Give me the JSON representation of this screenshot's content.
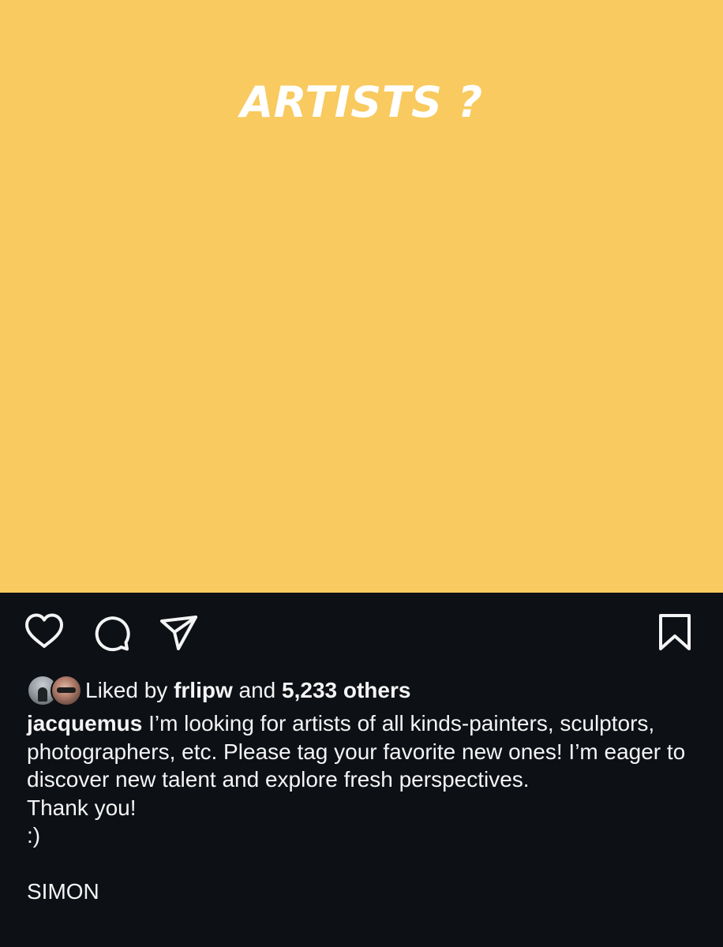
{
  "post": {
    "image": {
      "headline": "ARTISTS ?",
      "background_color": "#f8ca5f",
      "text_color": "#ffffff"
    },
    "actions": {
      "like_icon": "heart-icon",
      "comment_icon": "comment-icon",
      "share_icon": "paper-plane-icon",
      "save_icon": "bookmark-icon"
    },
    "likes": {
      "prefix": "Liked by",
      "user": "frlipw",
      "connector": "and",
      "others": "5,233 others"
    },
    "caption": {
      "author": "jacquemus",
      "text": "I’m looking for artists of all kinds-painters, sculptors, photographers, etc. Please tag your favorite new ones! I’m eager to discover new talent and explore fresh perspectives.",
      "line_thanks": "Thank you!",
      "line_smiley": ":)",
      "line_signature": "SIMON"
    }
  },
  "theme": {
    "background": "#0d1015",
    "text": "#f4f4f5"
  }
}
